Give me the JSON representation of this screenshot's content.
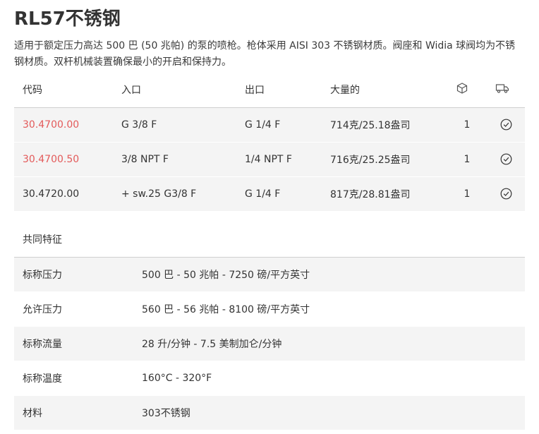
{
  "product": {
    "title": "RL57不锈钢",
    "description": "适用于额定压力高达 500 巴 (50 兆帕) 的泵的喷枪。枪体采用 AISI 303 不锈钢材质。阀座和 Widia 球阀均为不锈钢材质。双杆机械装置确保最小的开启和保持力。"
  },
  "spec_table": {
    "headers": [
      "代码",
      "入口",
      "出口",
      "大量的"
    ],
    "package_icon": "package-icon",
    "truck_icon": "truck-icon",
    "rows": [
      {
        "code": "30.4700.00",
        "inlet": "G 3/8 F",
        "outlet": "G 1/4 F",
        "weight": "714克/25.18盎司",
        "qty": "1",
        "status_icon": "check-circle-icon"
      },
      {
        "code": "30.4700.50",
        "inlet": "3/8 NPT F",
        "outlet": "1/4 NPT F",
        "weight": "716克/25.25盎司",
        "qty": "1",
        "status_icon": "check-circle-icon"
      },
      {
        "code": "30.4720.00",
        "inlet": "+ sw.25 G3/8 F",
        "outlet": "G 1/4 F",
        "weight": "817克/28.81盎司",
        "qty": "1",
        "status_icon": "check-circle-icon"
      }
    ],
    "link_color": "#e35a5a"
  },
  "features": {
    "title": "共同特征",
    "rows": [
      {
        "label": "标称压力",
        "value": "500 巴 - 50 兆帕 - 7250 磅/平方英寸"
      },
      {
        "label": "允许压力",
        "value": "560 巴 - 56 兆帕 - 8100 磅/平方英寸"
      },
      {
        "label": "标称流量",
        "value": "28 升/分钟 - 7.5 美制加仑/分钟"
      },
      {
        "label": "标称温度",
        "value": "160°C - 320°F"
      },
      {
        "label": "材料",
        "value": "303不锈钢"
      }
    ]
  }
}
